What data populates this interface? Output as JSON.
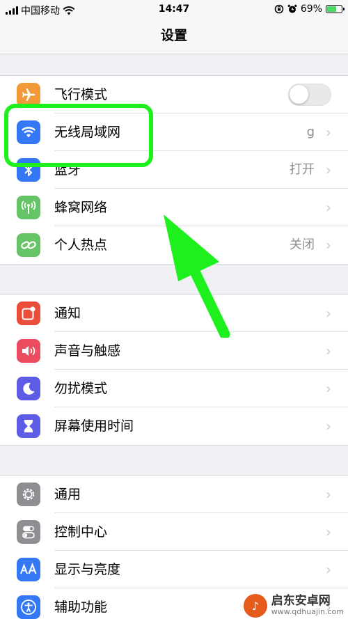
{
  "status_bar": {
    "carrier": "中国移动",
    "time": "14:47",
    "battery_percent": "69%",
    "battery_level": 0.69,
    "icons": [
      "signal-icon",
      "wifi-icon",
      "orientation-lock-icon",
      "alarm-icon",
      "battery-charging-icon"
    ]
  },
  "nav": {
    "title": "设置"
  },
  "groups": [
    {
      "rows": [
        {
          "label": "飞行模式",
          "icon": "airplane-icon",
          "color": "#f19a37",
          "control": "toggle",
          "toggle_on": false
        },
        {
          "label": "无线局域网",
          "icon": "wifi-icon",
          "color": "#3478f6",
          "value": "g",
          "control": "chevron"
        },
        {
          "label": "蓝牙",
          "icon": "bluetooth-icon",
          "color": "#3478f6",
          "value": "打开",
          "control": "chevron"
        },
        {
          "label": "蜂窝网络",
          "icon": "antenna-icon",
          "color": "#65c466",
          "control": "chevron"
        },
        {
          "label": "个人热点",
          "icon": "chain-link-icon",
          "color": "#65c466",
          "value": "关闭",
          "control": "chevron"
        }
      ]
    },
    {
      "rows": [
        {
          "label": "通知",
          "icon": "notification-icon",
          "color": "#eb4d3d",
          "control": "chevron"
        },
        {
          "label": "声音与触感",
          "icon": "speaker-icon",
          "color": "#eb4d5f",
          "control": "chevron"
        },
        {
          "label": "勿扰模式",
          "icon": "moon-icon",
          "color": "#5e5ce6",
          "control": "chevron"
        },
        {
          "label": "屏幕使用时间",
          "icon": "hourglass-icon",
          "color": "#5e5ce6",
          "control": "chevron"
        }
      ]
    },
    {
      "rows": [
        {
          "label": "通用",
          "icon": "gear-icon",
          "color": "#8e8e93",
          "control": "chevron"
        },
        {
          "label": "控制中心",
          "icon": "toggles-icon",
          "color": "#8e8e93",
          "control": "chevron"
        },
        {
          "label": "显示与亮度",
          "icon": "text-size-icon",
          "color": "#3478f6",
          "control": "chevron"
        },
        {
          "label": "辅助功能",
          "icon": "accessibility-icon",
          "color": "#3478f6",
          "control": "chevron"
        }
      ]
    }
  ],
  "annotation": {
    "color": "#1ef01e"
  },
  "watermark": {
    "name": "启东安卓网",
    "url": "www.qdhuajin.com"
  }
}
